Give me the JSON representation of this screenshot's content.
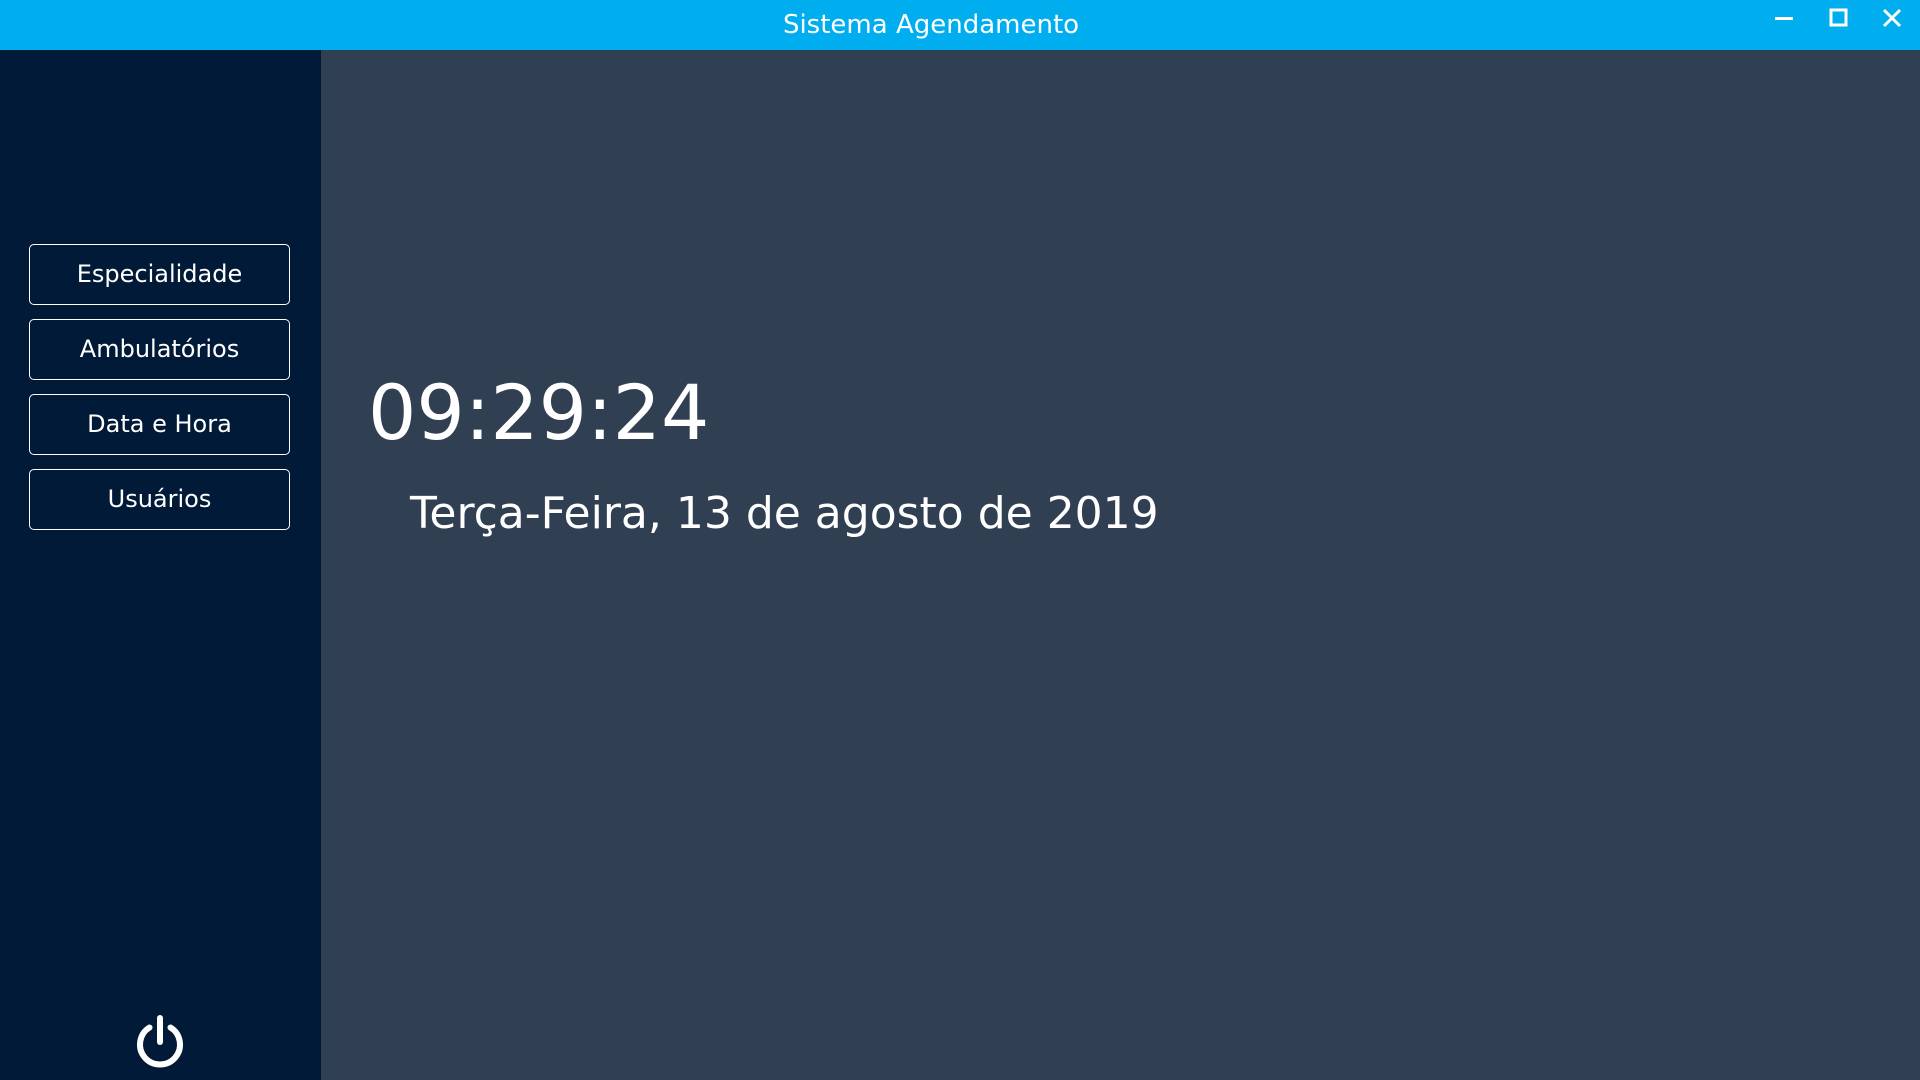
{
  "window": {
    "title": "Sistema Agendamento",
    "controls": {
      "minimize_icon": "minimize-icon",
      "maximize_icon": "maximize-icon",
      "close_icon": "close-icon"
    }
  },
  "sidebar": {
    "items": [
      {
        "label": "Especialidade"
      },
      {
        "label": "Ambulatórios"
      },
      {
        "label": "Data e Hora"
      },
      {
        "label": "Usuários"
      }
    ],
    "power_icon": "power-icon"
  },
  "main": {
    "time": "09:29:24",
    "date": "Terça-Feira, 13 de agosto de 2019"
  },
  "colors": {
    "titlebar": "#00aeef",
    "sidebar": "#011a37",
    "content": "#313f53",
    "text": "#ffffff"
  }
}
